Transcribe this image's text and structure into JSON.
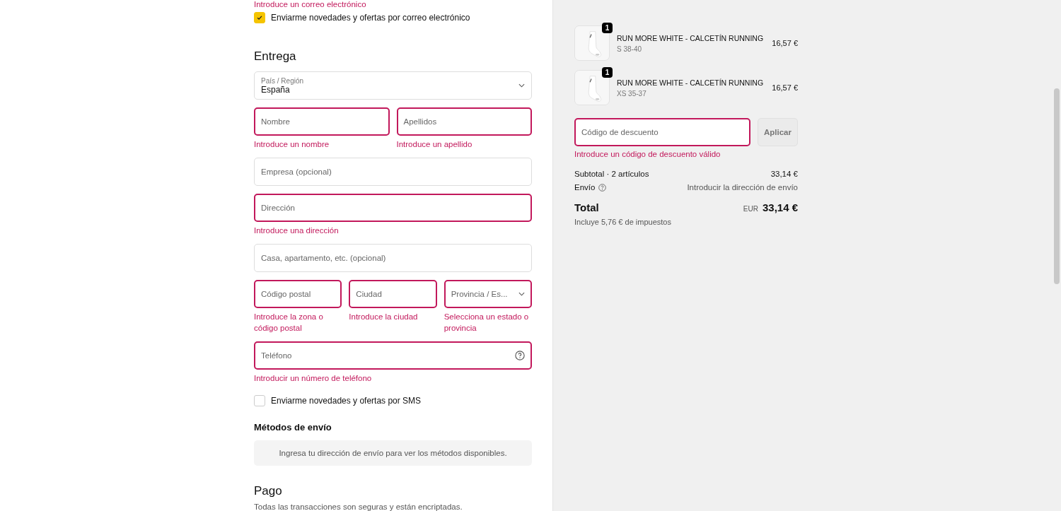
{
  "contact": {
    "error": "Introduce un correo electrónico",
    "newsletter": {
      "label": "Enviarme novedades y ofertas por correo electrónico",
      "checked": true
    }
  },
  "delivery": {
    "title": "Entrega",
    "rows": [
      [
        {
          "kind": "select",
          "label": "País / Región",
          "value": "España",
          "invalid": false
        }
      ],
      [
        {
          "kind": "text",
          "placeholder": "Nombre",
          "invalid": true,
          "error": "Introduce un nombre"
        },
        {
          "kind": "text",
          "placeholder": "Apellidos",
          "invalid": true,
          "error": "Introduce un apellido"
        }
      ],
      [
        {
          "kind": "text",
          "placeholder": "Empresa (opcional)",
          "invalid": false
        }
      ],
      [
        {
          "kind": "text",
          "placeholder": "Dirección",
          "invalid": true,
          "error": "Introduce una dirección"
        }
      ],
      [
        {
          "kind": "text",
          "placeholder": "Casa, apartamento, etc. (opcional)",
          "invalid": false
        }
      ],
      [
        {
          "kind": "text",
          "placeholder": "Código postal",
          "invalid": true,
          "error": "Introduce la zona o código postal"
        },
        {
          "kind": "text",
          "placeholder": "Ciudad",
          "invalid": true,
          "error": "Introduce la ciudad"
        },
        {
          "kind": "select",
          "placeholder": "Provincia / Es...",
          "invalid": true,
          "error": "Selecciona un estado o provincia"
        }
      ],
      [
        {
          "kind": "phone",
          "placeholder": "Teléfono",
          "invalid": true,
          "error": "Introducir un número de teléfono"
        }
      ]
    ],
    "sms": {
      "label": "Enviarme novedades y ofertas por SMS",
      "checked": false
    }
  },
  "shipping": {
    "title": "Métodos de envío",
    "notice": "Ingresa tu dirección de envío para ver los métodos disponibles."
  },
  "payment": {
    "title": "Pago",
    "subtitle": "Todas las transacciones son seguras y están encriptadas."
  },
  "summary": {
    "items": [
      {
        "quantity": "1",
        "name": "RUN MORE WHITE - CALCETÍN RUNNING",
        "variant": "S 38-40",
        "price": "16,57 €"
      },
      {
        "quantity": "1",
        "name": "RUN MORE WHITE - CALCETÍN RUNNING",
        "variant": "XS 35-37",
        "price": "16,57 €"
      }
    ],
    "discount": {
      "placeholder": "Código de descuento",
      "invalid": true,
      "error": "Introduce un código de descuento válido",
      "button": "Aplicar"
    },
    "subtotal_label": "Subtotal · 2 artículos",
    "subtotal": "33,14 €",
    "shipping_label": "Envío",
    "shipping_value": "Introducir la dirección de envío",
    "total_label": "Total",
    "currency": "EUR",
    "total": "33,14 €",
    "taxes": "Incluye 5,76 € de impuestos"
  }
}
